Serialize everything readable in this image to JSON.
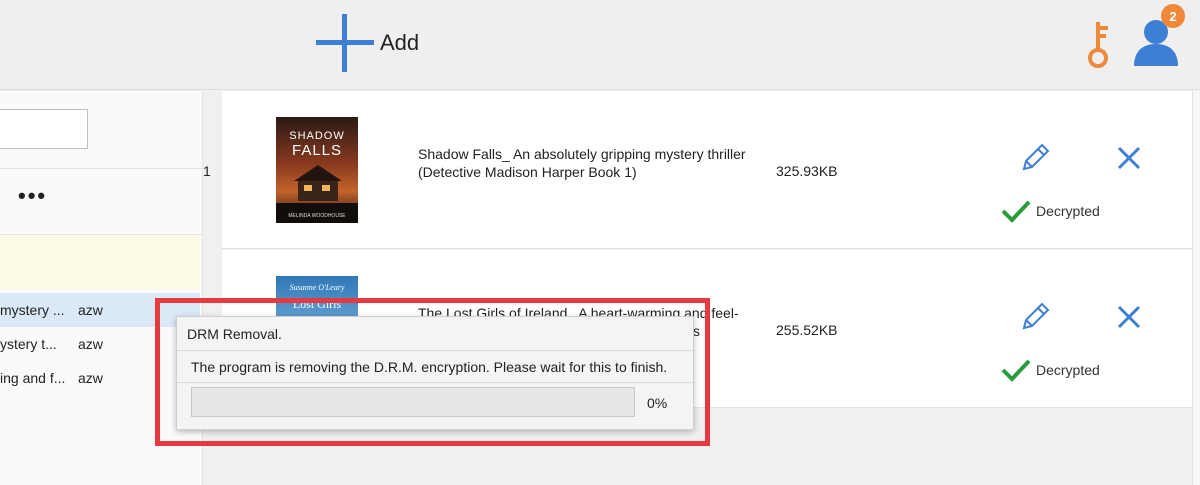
{
  "toolbar": {
    "add_label": "Add",
    "notification_count": "2",
    "accent_color": "#3d7fd4",
    "key_color": "#f0883a",
    "user_color": "#3d7fd4"
  },
  "sidebar": {
    "search_value": "",
    "more_label": "•••",
    "books": [
      {
        "title": "mystery ...",
        "format": "azw",
        "selected": true
      },
      {
        "title": "ystery t...",
        "format": "azw",
        "selected": false
      },
      {
        "title": "ing and f...",
        "format": "azw",
        "selected": false
      }
    ],
    "row_number": "1"
  },
  "main": {
    "rows": [
      {
        "title": "Shadow Falls_ An absolutely gripping mystery thriller (Detective Madison Harper Book 1)",
        "size": "325.93KB",
        "status": "Decrypted",
        "cover": {
          "title_line1": "SHADOW",
          "title_line2": "FALLS",
          "author": "MELINDA WOODHOUSE"
        }
      },
      {
        "title_line1": "The Lost Girls of Ireland_ A heart-warming and feel-",
        "title_line2": "otages",
        "size": "255.52KB",
        "status": "Decrypted",
        "cover": {
          "author": "Susanne O'Leary",
          "title": "Lost Girls"
        }
      }
    ]
  },
  "dialog": {
    "title": "DRM Removal.",
    "message": "The program is removing the D.R.M. encryption. Please wait for this to finish.",
    "progress_percent": "0%",
    "progress_value": 0
  },
  "colors": {
    "highlight_frame": "#e53a3f",
    "check_green": "#2a9d3a"
  }
}
